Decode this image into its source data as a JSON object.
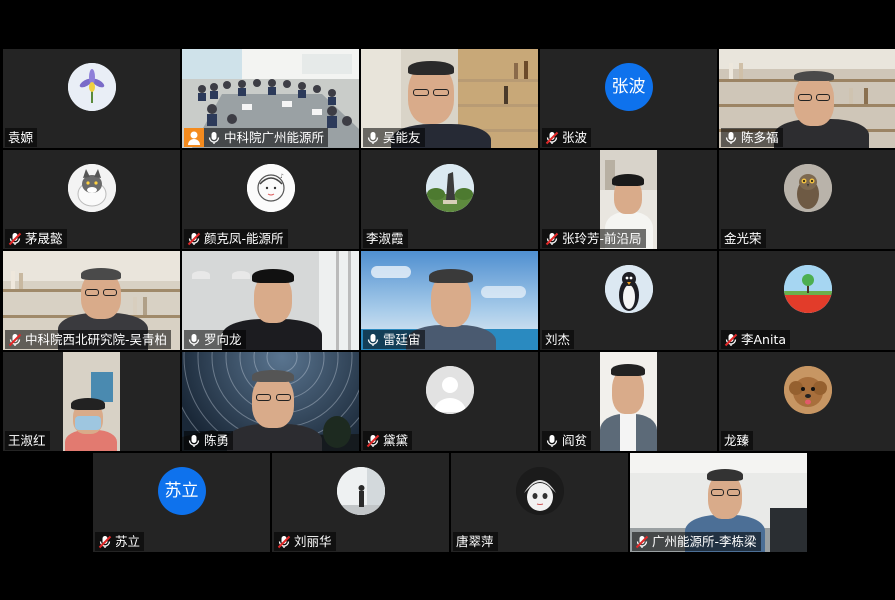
{
  "participants": {
    "p1": {
      "name": "袁嫄",
      "mic": "none"
    },
    "p2": {
      "name": "中科院广州能源所",
      "mic": "on"
    },
    "p3": {
      "name": "吴能友",
      "mic": "on"
    },
    "p4": {
      "name": "张波",
      "mic": "muted",
      "initials": "张波"
    },
    "p5": {
      "name": "陈多福",
      "mic": "on"
    },
    "p6": {
      "name": "茅晟懿",
      "mic": "muted"
    },
    "p7": {
      "name": "颜克凤-能源所",
      "mic": "muted"
    },
    "p8": {
      "name": "李淑霞",
      "mic": "none"
    },
    "p9": {
      "name": "张玲芳-前沿局",
      "mic": "muted"
    },
    "p10": {
      "name": "金光荣",
      "mic": "none"
    },
    "p11": {
      "name": "中科院西北研究院-吴青柏",
      "mic": "muted"
    },
    "p12": {
      "name": "罗向龙",
      "mic": "on"
    },
    "p13": {
      "name": "雷廷宙",
      "mic": "on"
    },
    "p14": {
      "name": "刘杰",
      "mic": "none"
    },
    "p15": {
      "name": "李Anita",
      "mic": "muted"
    },
    "p16": {
      "name": "王淑红",
      "mic": "none"
    },
    "p17": {
      "name": "陈勇",
      "mic": "on"
    },
    "p18": {
      "name": "黛黛",
      "mic": "muted"
    },
    "p19": {
      "name": "阎贫",
      "mic": "on"
    },
    "p20": {
      "name": "龙臻",
      "mic": "none"
    },
    "p21": {
      "name": "苏立",
      "mic": "muted",
      "initials": "苏立"
    },
    "p22": {
      "name": "刘丽华",
      "mic": "muted"
    },
    "p23": {
      "name": "唐翠萍",
      "mic": "none"
    },
    "p24": {
      "name": "广州能源所-李栋梁",
      "mic": "muted"
    }
  },
  "colors": {
    "tile_bg": "#242424",
    "active_speaker": "#2fc65a",
    "initials_avatar": "#0e72ed",
    "muted_icon": "#e02828"
  }
}
